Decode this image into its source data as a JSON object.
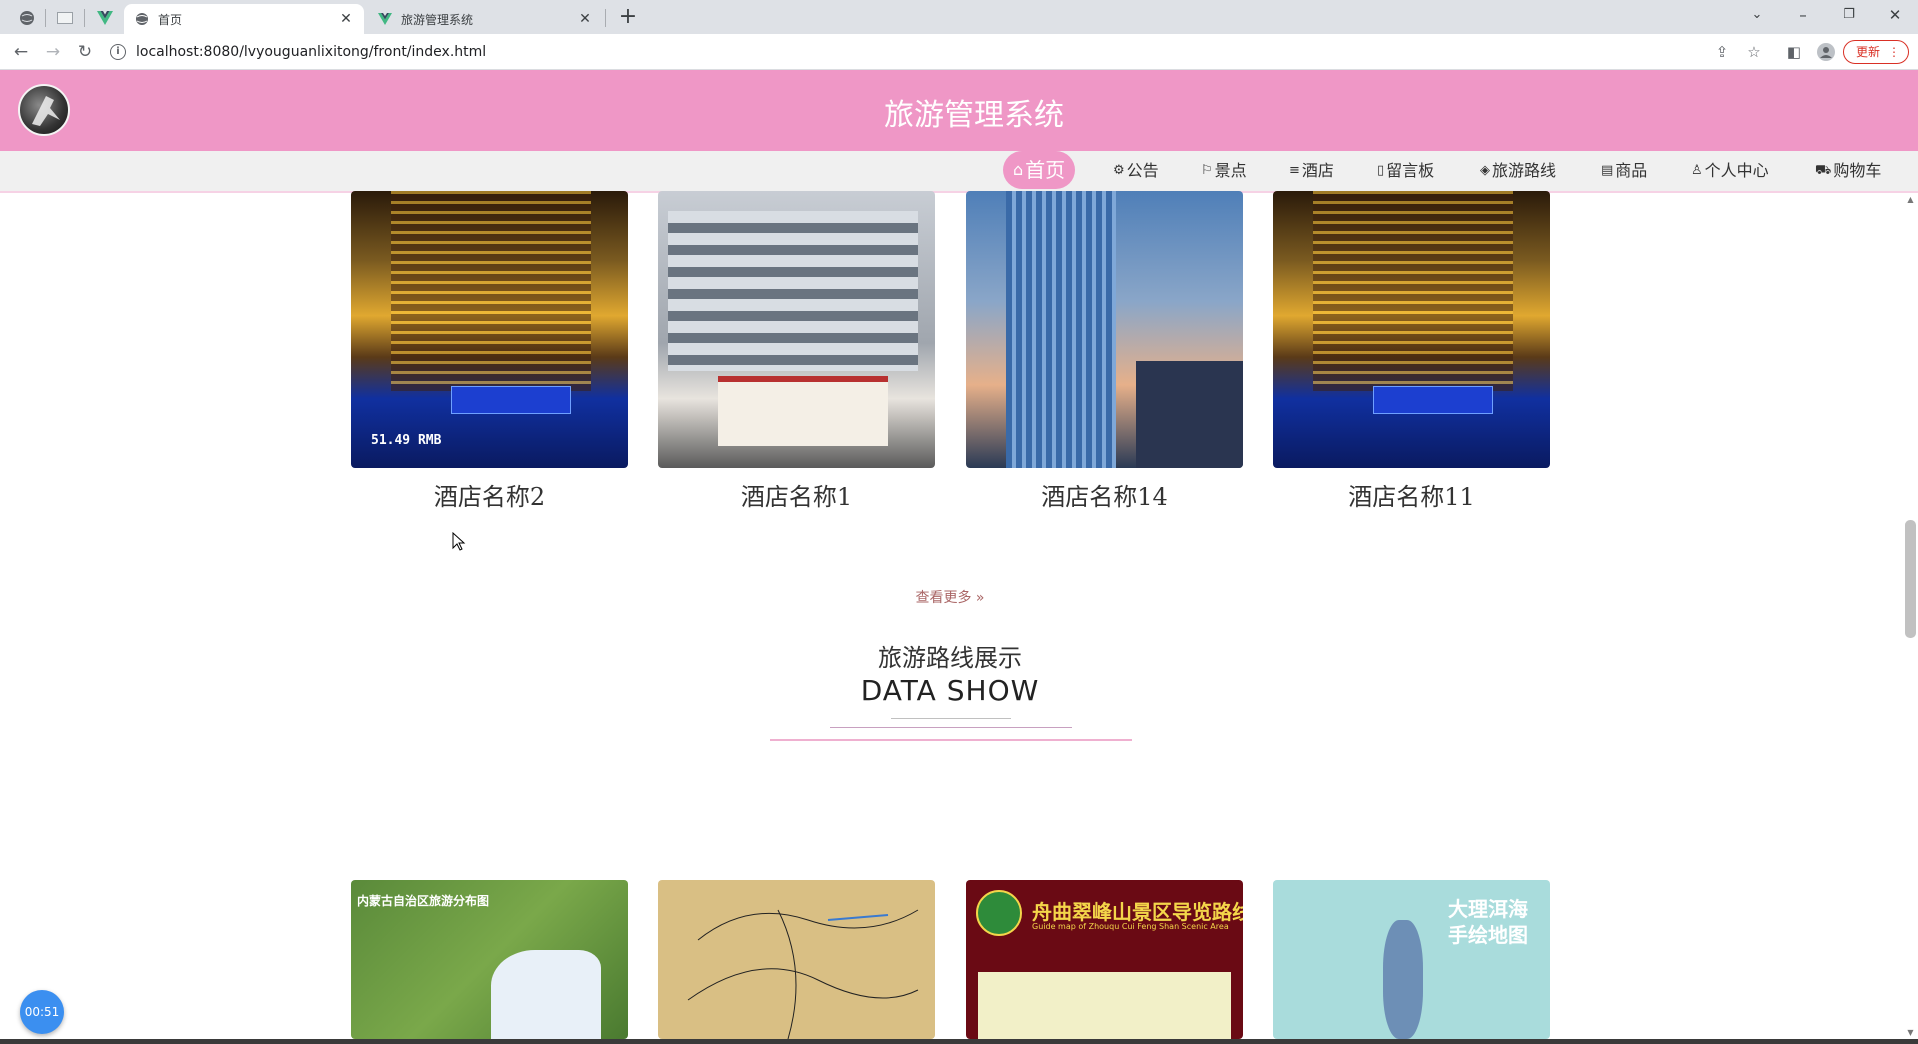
{
  "browser": {
    "tabs": [
      {
        "title": "首页",
        "active": true
      },
      {
        "title": "旅游管理系统",
        "active": false
      }
    ],
    "url": "localhost:8080/lvyouguanlixitong/front/index.html",
    "update_label": "更新"
  },
  "site": {
    "title": "旅游管理系统",
    "nav": [
      {
        "icon": "⌂",
        "label": "首页"
      },
      {
        "icon": "⚙",
        "label": "公告"
      },
      {
        "icon": "⚐",
        "label": "景点"
      },
      {
        "icon": "≡",
        "label": "酒店"
      },
      {
        "icon": "▯",
        "label": "留言板"
      },
      {
        "icon": "◈",
        "label": "旅游路线"
      },
      {
        "icon": "▤",
        "label": "商品"
      },
      {
        "icon": "♙",
        "label": "个人中心"
      },
      {
        "icon": "⛟",
        "label": "购物车"
      }
    ]
  },
  "hotels": [
    {
      "name": "酒店名称2",
      "price": "51.49 RMB"
    },
    {
      "name": "酒店名称1"
    },
    {
      "name": "酒店名称14"
    },
    {
      "name": "酒店名称11"
    }
  ],
  "more_label": "查看更多 »",
  "routes_section": {
    "title": "旅游路线展示",
    "subtitle": "DATA SHOW"
  },
  "route_cards": [
    {
      "caption": "内蒙古自治区旅游分布图"
    },
    {
      "caption": ""
    },
    {
      "caption": "舟曲翠峰山景区导览路线图",
      "caption_en": "Guide map of Zhouqu Cui Feng Shan Scenic Area"
    },
    {
      "caption": "大理洱海手绘地图"
    }
  ],
  "timer": "00:51",
  "colors": {
    "brand_pink": "#ef97c6",
    "menu_bg": "#f0f0f0"
  }
}
